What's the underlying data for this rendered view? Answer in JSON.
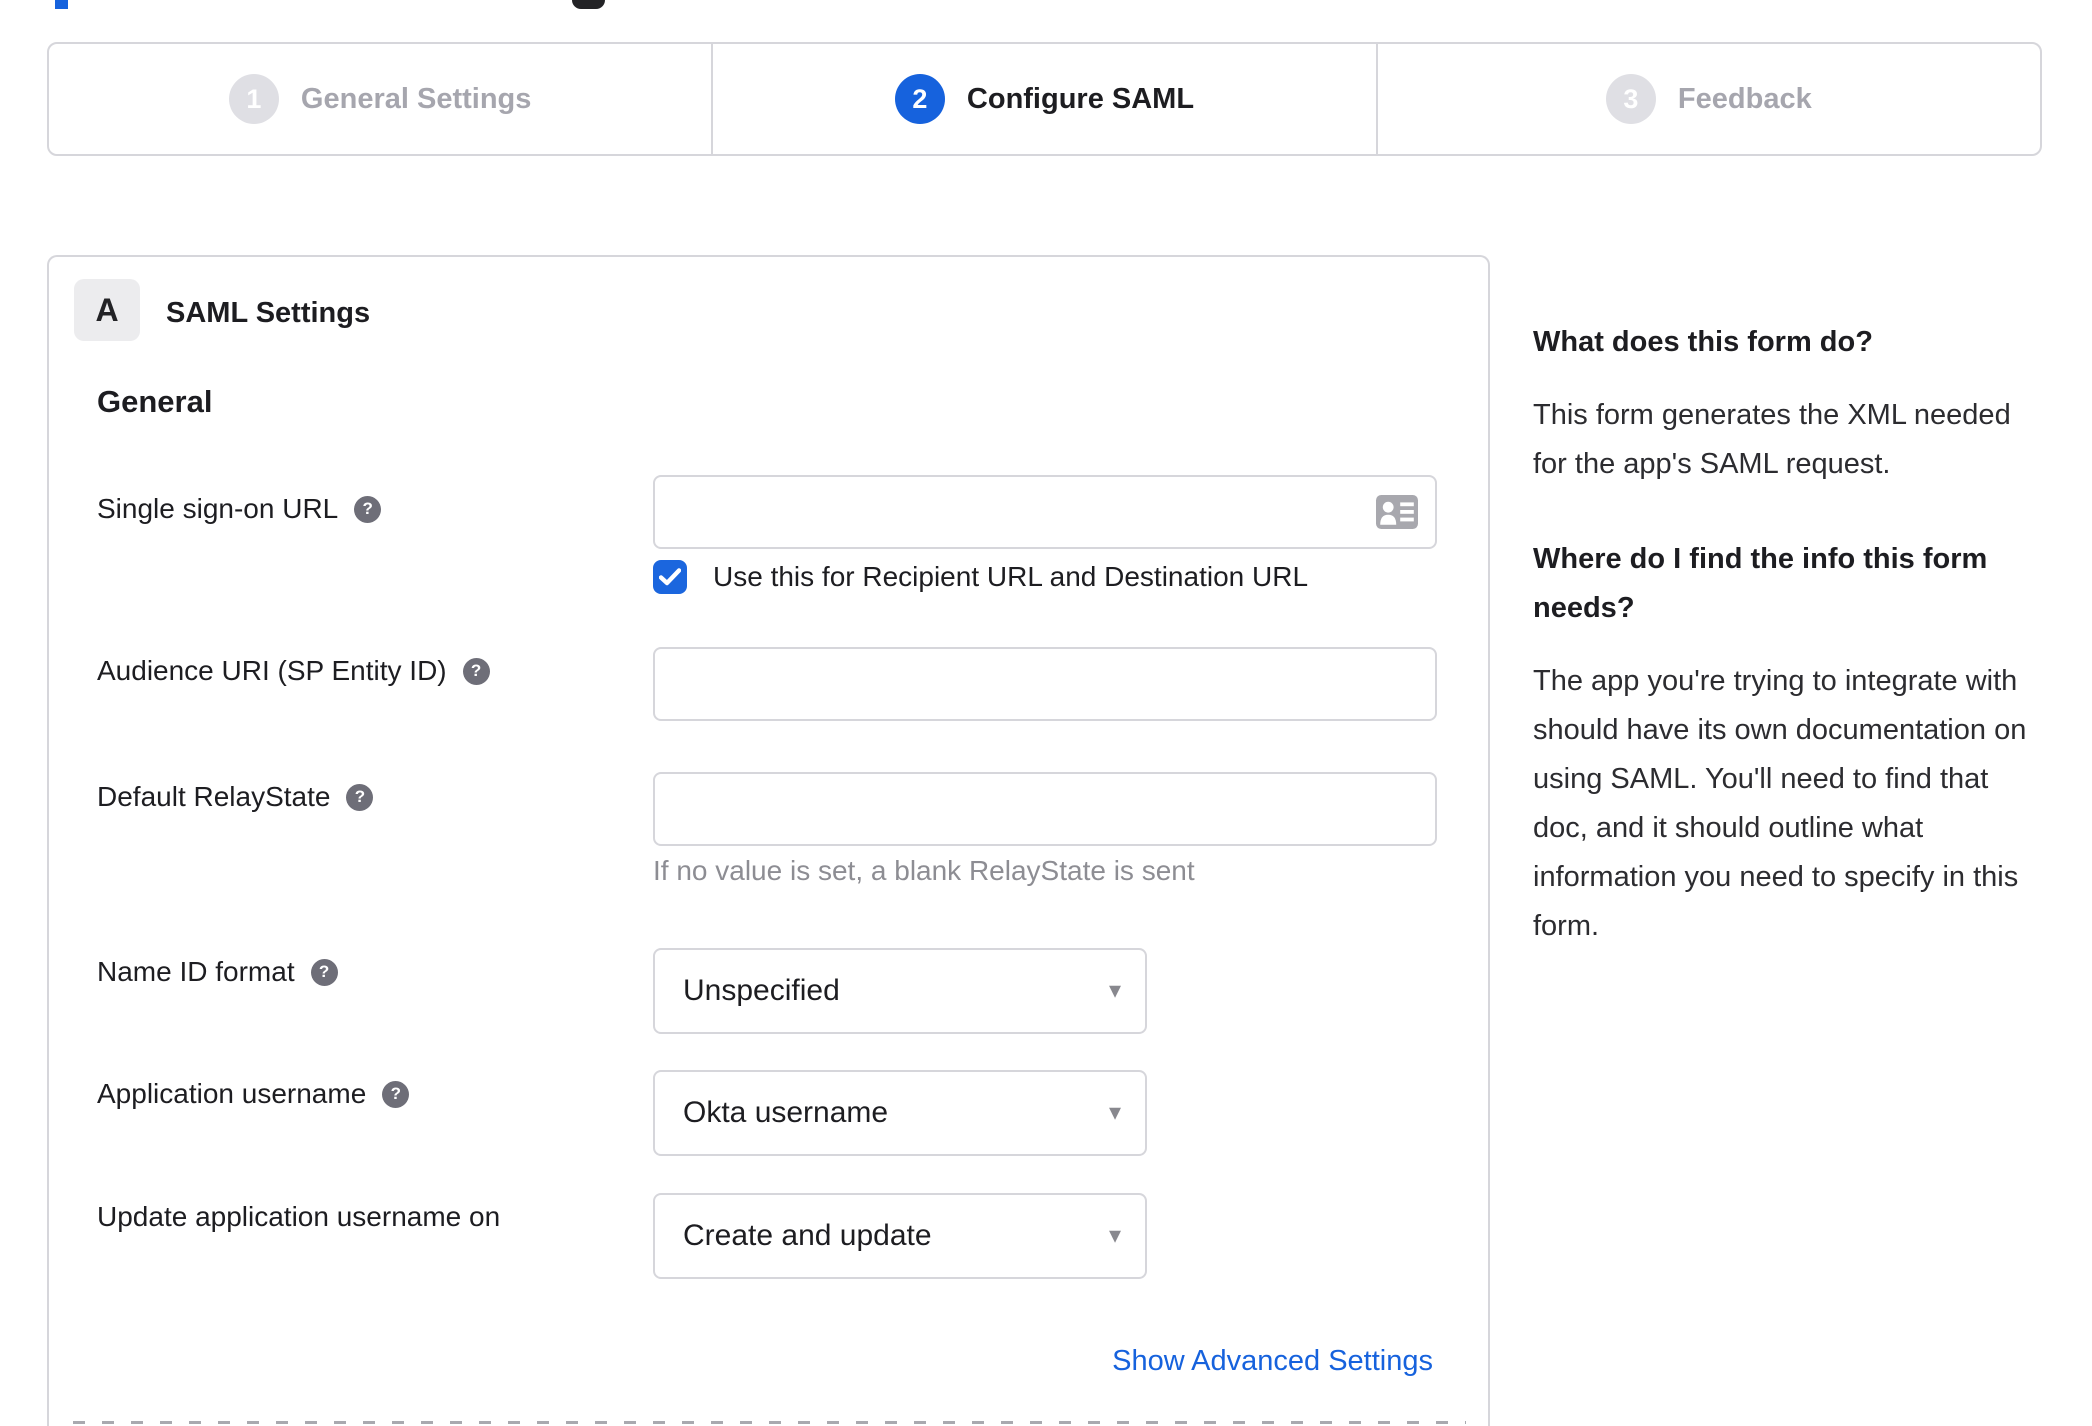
{
  "page": {
    "accent_color": "#1662dd",
    "border_color": "#d6d6db",
    "inactive_color": "#a6a6ae"
  },
  "stepper": {
    "steps": [
      {
        "number": "1",
        "label": "General Settings",
        "state": "inactive"
      },
      {
        "number": "2",
        "label": "Configure SAML",
        "state": "active"
      },
      {
        "number": "3",
        "label": "Feedback",
        "state": "inactive"
      }
    ]
  },
  "panel": {
    "section_badge": "A",
    "section_title": "SAML Settings",
    "group_heading": "General",
    "advanced_link": "Show Advanced Settings"
  },
  "form": {
    "sso": {
      "label": "Single sign-on URL",
      "value": "",
      "checkbox_label": "Use this for Recipient URL and Destination URL",
      "checkbox_checked": true
    },
    "audience": {
      "label": "Audience URI (SP Entity ID)",
      "value": ""
    },
    "relay": {
      "label": "Default RelayState",
      "value": "",
      "hint": "If no value is set, a blank RelayState is sent"
    },
    "name_id_format": {
      "label": "Name ID format",
      "selected": "Unspecified"
    },
    "application_username": {
      "label": "Application username",
      "selected": "Okta username"
    },
    "update_application_username": {
      "label": "Update application username on",
      "selected": "Create and update"
    }
  },
  "sidebar": {
    "question1": "What does this form do?",
    "answer1": "This form generates the XML needed for the app's SAML request.",
    "question2": "Where do I find the info this form needs?",
    "answer2": "The app you're trying to integrate with should have its own documentation on using SAML. You'll need to find that doc, and it should outline what information you need to specify in this form."
  },
  "icons": {
    "help": "?",
    "caret": "▾"
  }
}
